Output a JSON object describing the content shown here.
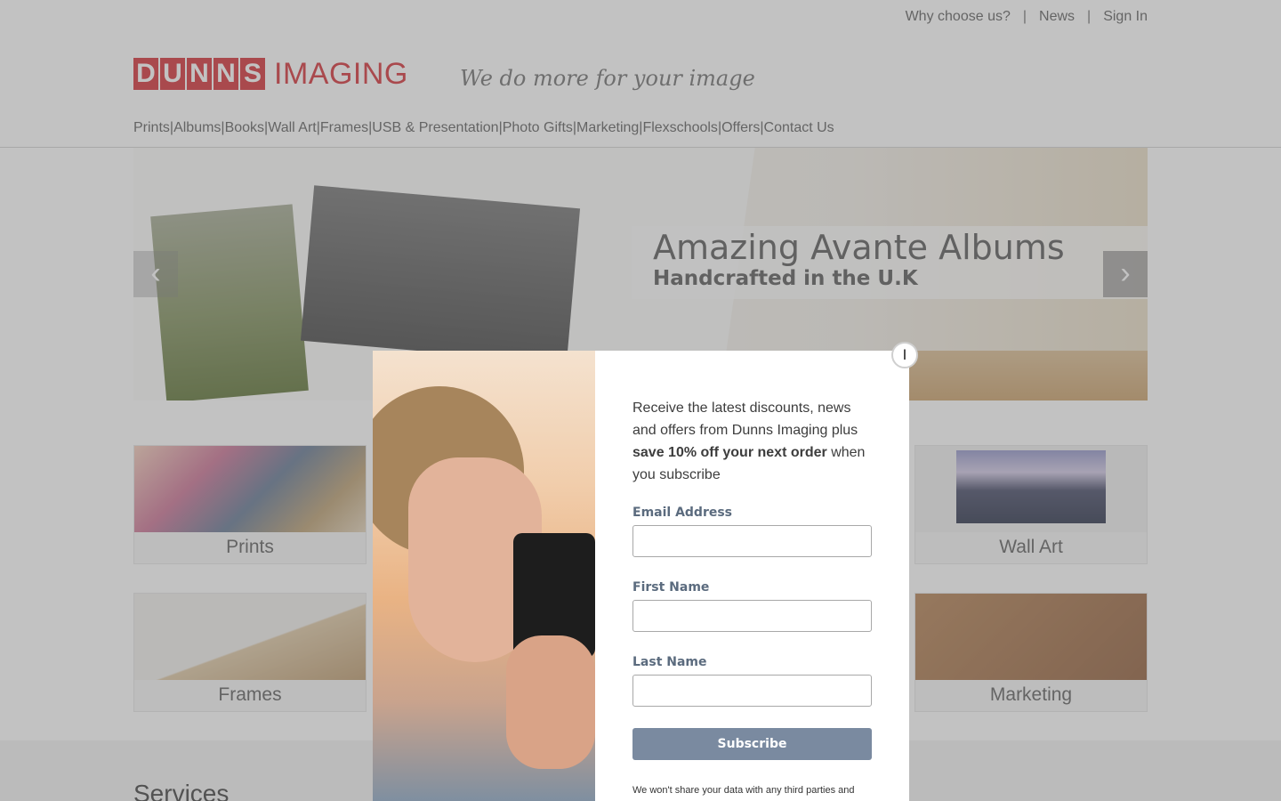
{
  "top_links": [
    "Why choose us?",
    "News",
    "Sign In"
  ],
  "top_links_separator": "|",
  "logo": {
    "letters": [
      "D",
      "U",
      "N",
      "N",
      "S"
    ],
    "word": "IMAGING",
    "brand_color": "#d2232a"
  },
  "tagline": "We do more for your image",
  "nav": {
    "items": [
      "Prints",
      "Albums",
      "Books",
      "Wall Art",
      "Frames",
      "USB & Presentation",
      "Photo Gifts",
      "Marketing",
      "Flexschools",
      "Offers",
      "Contact Us"
    ],
    "separator": "|"
  },
  "hero": {
    "title": "Amazing Avante Albums",
    "subtitle": "Handcrafted in the U.K",
    "prev_icon": "‹",
    "next_icon": "›"
  },
  "tiles": {
    "prints": "Prints",
    "wall_art": "Wall Art",
    "frames": "Frames",
    "marketing": "Marketing"
  },
  "services_heading": "Services",
  "modal": {
    "intro_start": "Receive the latest discounts, news and offers from Dunns Imaging plus ",
    "intro_bold": "save 10% off your next order",
    "intro_end": " when you subscribe",
    "email_label": "Email Address",
    "first_name_label": "First Name",
    "last_name_label": "Last Name",
    "email_value": "",
    "first_name_value": "",
    "last_name_value": "",
    "subscribe_label": "Subscribe",
    "disclaimer": "We won't share your data with any third parties and",
    "close_glyph": "I",
    "button_color": "#7a8aa0"
  }
}
